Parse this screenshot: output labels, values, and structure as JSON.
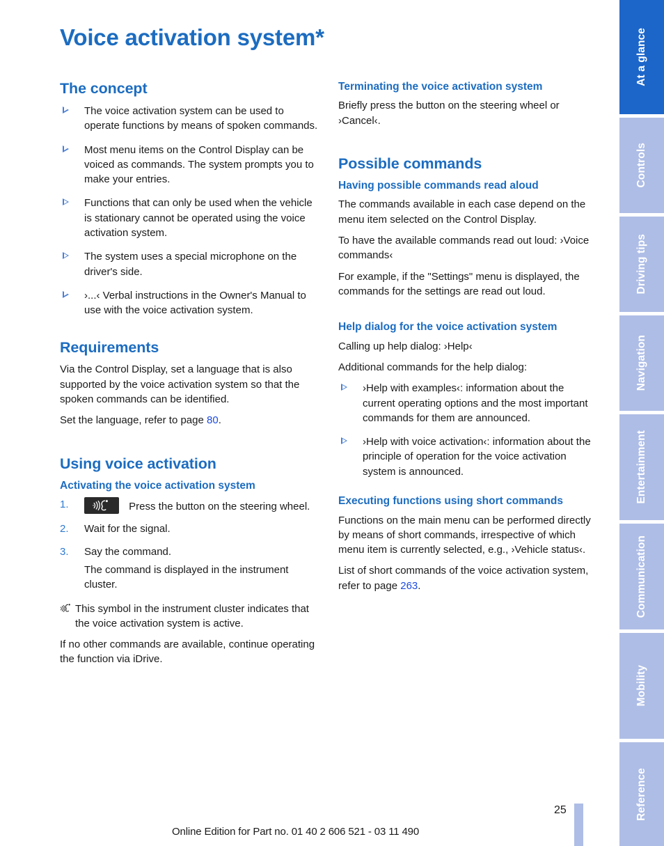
{
  "page": {
    "title": "Voice activation system*",
    "number": "25",
    "footer": "Online Edition for Part no. 01 40 2 606 521 - 03 11 490",
    "accent_blue": "#1c6cc0",
    "link_blue": "#1c4ae0",
    "tab_active_blue": "#1d66c9",
    "tab_inactive_blue": "#aebde5"
  },
  "tabs": [
    {
      "label": "At a glance",
      "active": true
    },
    {
      "label": "Controls",
      "active": false
    },
    {
      "label": "Driving tips",
      "active": false
    },
    {
      "label": "Navigation",
      "active": false
    },
    {
      "label": "Entertainment",
      "active": false
    },
    {
      "label": "Communication",
      "active": false
    },
    {
      "label": "Mobility",
      "active": false
    },
    {
      "label": "Reference",
      "active": false
    }
  ],
  "left_column": {
    "concept": {
      "heading": "The concept",
      "bullets": [
        "The voice activation system can be used to operate functions by means of spoken commands.",
        "Most menu items on the Control Display can be voiced as commands. The system prompts you to make your entries.",
        "Functions that can only be used when the vehicle is stationary cannot be operated using the voice activation system.",
        "The system uses a special microphone on the driver's side.",
        "›...‹ Verbal instructions in the Owner's Manual to use with the voice activation system."
      ]
    },
    "requirements": {
      "heading": "Requirements",
      "paragraph": "Via the Control Display, set a language that is also supported by the voice activation system so that the spoken commands can be identified.",
      "refer_prefix": "Set the language, refer to page ",
      "refer_page": "80",
      "refer_suffix": "."
    },
    "using": {
      "heading": "Using voice activation",
      "subheading": "Activating the voice activation system",
      "steps": [
        {
          "num": "1.",
          "icon": "voice-button-icon",
          "text": "Press the button on the steering wheel."
        },
        {
          "num": "2.",
          "icon": null,
          "text": "Wait for the signal."
        },
        {
          "num": "3.",
          "icon": null,
          "text": "Say the command.",
          "sub": "The command is displayed in the instrument cluster."
        }
      ],
      "note_icon": "voice-active-symbol-icon",
      "note": "This symbol in the instrument cluster indicates that the voice activation system is active.",
      "closing": "If no other commands are available, continue operating the function via iDrive."
    }
  },
  "right_column": {
    "terminating": {
      "heading": "Terminating the voice activation system",
      "paragraph": "Briefly press the button on the steering wheel or ›Cancel‹."
    },
    "possible_commands": {
      "heading": "Possible commands",
      "read_aloud": {
        "subheading": "Having possible commands read aloud",
        "p1": "The commands available in each case depend on the menu item selected on the Control Display.",
        "p2": "To have the available commands read out loud: ›Voice commands‹",
        "p3": "For example, if the \"Settings\" menu is displayed, the commands for the settings are read out loud."
      },
      "help_dialog": {
        "subheading": "Help dialog for the voice activation system",
        "p1": "Calling up help dialog: ›Help‹",
        "p2": "Additional commands for the help dialog:",
        "bullets": [
          "›Help with examples‹: information about the current operating options and the most important commands for them are announced.",
          "›Help with voice activation‹: information about the principle of operation for the voice activation system is announced."
        ]
      },
      "short_commands": {
        "subheading": "Executing functions using short commands",
        "p1": "Functions on the main menu can be performed directly by means of short commands, irrespective of which menu item is currently selected, e.g., ›Vehicle status‹.",
        "refer_prefix": "List of short commands of the voice activation system, refer to page ",
        "refer_page": "263",
        "refer_suffix": "."
      }
    }
  }
}
